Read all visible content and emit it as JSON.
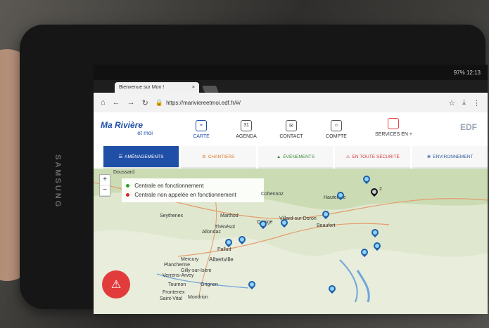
{
  "device": {
    "brand": "SAMSUNG"
  },
  "statusbar": {
    "left": "",
    "right": "97% 12:13"
  },
  "browser": {
    "tab_title": "Bienvenue sur Mon !",
    "tab_close": "×",
    "url": "https://mariviereetmoi.edf.fr/#/"
  },
  "header": {
    "logo_main": "Ma Rivière",
    "logo_sub": "et moi",
    "nav": [
      {
        "label": "CARTE",
        "icon": "map-pin-icon"
      },
      {
        "label": "AGENDA",
        "icon": "calendar-icon",
        "day": "31"
      },
      {
        "label": "CONTACT",
        "icon": "mail-icon"
      },
      {
        "label": "COMPTE",
        "icon": "user-icon"
      }
    ],
    "services_label": "SERVICES EN +",
    "edf_logo": "EDF"
  },
  "categories": [
    {
      "label": "AMÉNAGEMENTS",
      "icon": "list-icon"
    },
    {
      "label": "CHANTIERS",
      "icon": "worksite-icon"
    },
    {
      "label": "ÉVÉNEMENTS",
      "icon": "event-icon"
    },
    {
      "label": "EN TOUTE SÉCURITÉ",
      "icon": "warning-icon"
    },
    {
      "label": "ENVIRONNEMENT",
      "icon": "environment-icon"
    }
  ],
  "map": {
    "legend": [
      {
        "label": "Centrale en fonctionnement",
        "color": "#2ca02c"
      },
      {
        "label": "Centrale non appelée en fonctionnement",
        "color": "#d62728"
      }
    ],
    "places": [
      "Doussard",
      "Cohennoz",
      "Hauteluce",
      "Beaufort",
      "Seythenex",
      "Marthod",
      "Thénésol",
      "Allondaz",
      "Pallud",
      "Mercury",
      "Albertville",
      "Plancherine",
      "Gilly-sur-Isère",
      "Verrens-Arvey",
      "Tournon",
      "Frontenex",
      "Grignon",
      "Monthion",
      "Saint-Vital",
      "Queige",
      "Villard-sur-Doron"
    ],
    "cluster_count": "2",
    "alert_icon": "siren-icon"
  }
}
